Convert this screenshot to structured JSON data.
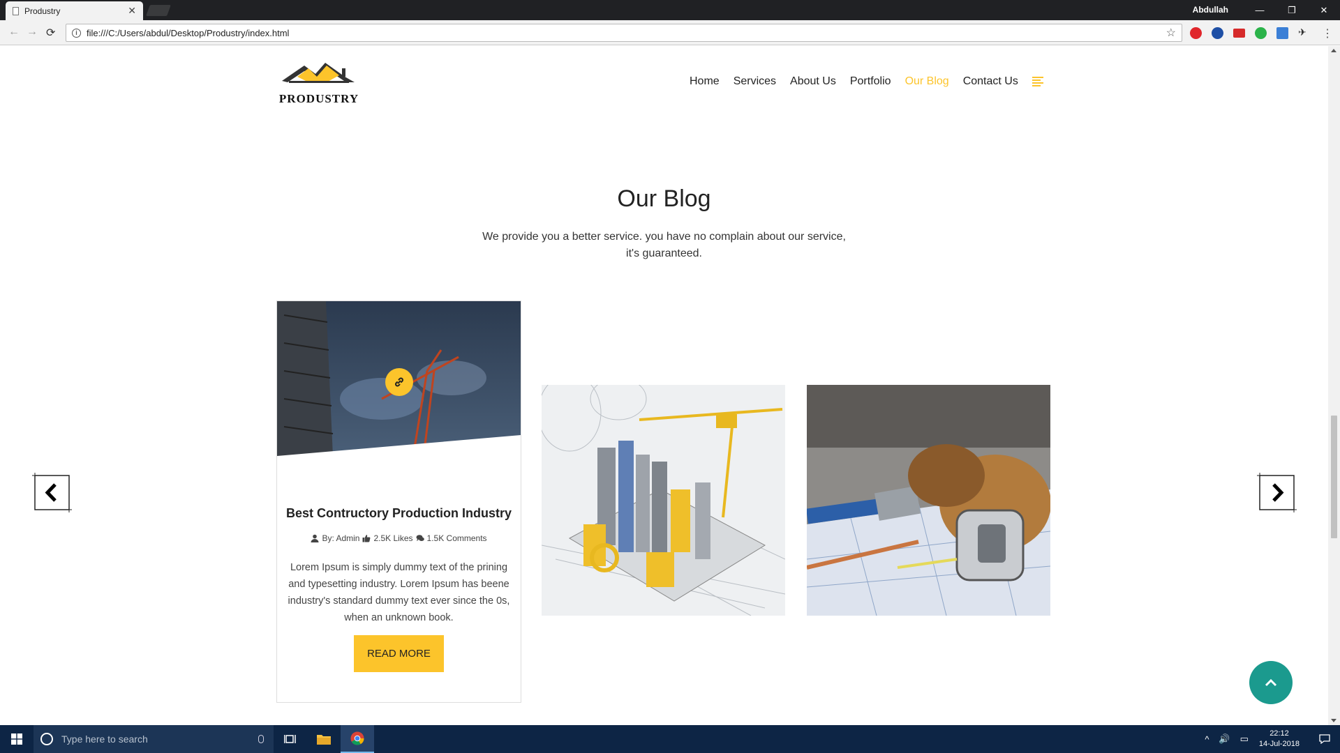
{
  "browser": {
    "tab_title": "Produstry",
    "tab_close": "✕",
    "profile_name": "Abdullah",
    "minimize": "—",
    "maximize": "❐",
    "close": "✕",
    "back": "←",
    "forward": "→",
    "reload": "⟳",
    "url": "file:///C:/Users/abdul/Desktop/Produstry/index.html",
    "info": "i",
    "star": "☆",
    "menu": "⋮",
    "extension_icons": [
      "opera-red-icon",
      "globe-blue-icon",
      "red-ext-icon",
      "green-ext-icon",
      "blue-ext-icon",
      "pin-ext-icon"
    ]
  },
  "header": {
    "logo_text": "PRODUSTRY",
    "nav": [
      {
        "label": "Home"
      },
      {
        "label": "Services"
      },
      {
        "label": "About Us"
      },
      {
        "label": "Portfolio"
      },
      {
        "label": "Our Blog",
        "active": true
      },
      {
        "label": "Contact Us"
      }
    ]
  },
  "section": {
    "title": "Our Blog",
    "subtitle": "We provide you a better service. you have no complain about our service, it's guaranteed."
  },
  "blog_card": {
    "title": "Best Contructory Production Industry",
    "author": "By: Admin",
    "likes": "2.5K Likes",
    "comments": "1.5K Comments",
    "body": "Lorem Ipsum is simply dummy text of the prining and typesetting industry. Lorem Ipsum has beene industry's standard dummy text ever since the 0s, when an unknown book.",
    "button": "READ MORE"
  },
  "colors": {
    "accent": "#fcc42b",
    "back_to_top": "#1b9a8e",
    "taskbar": "#0d2545"
  },
  "taskbar": {
    "search_placeholder": "Type here to search",
    "time": "22:12",
    "date": "14-Jul-2018",
    "tray_up": "^",
    "volume": "🔊",
    "network": "▭"
  }
}
